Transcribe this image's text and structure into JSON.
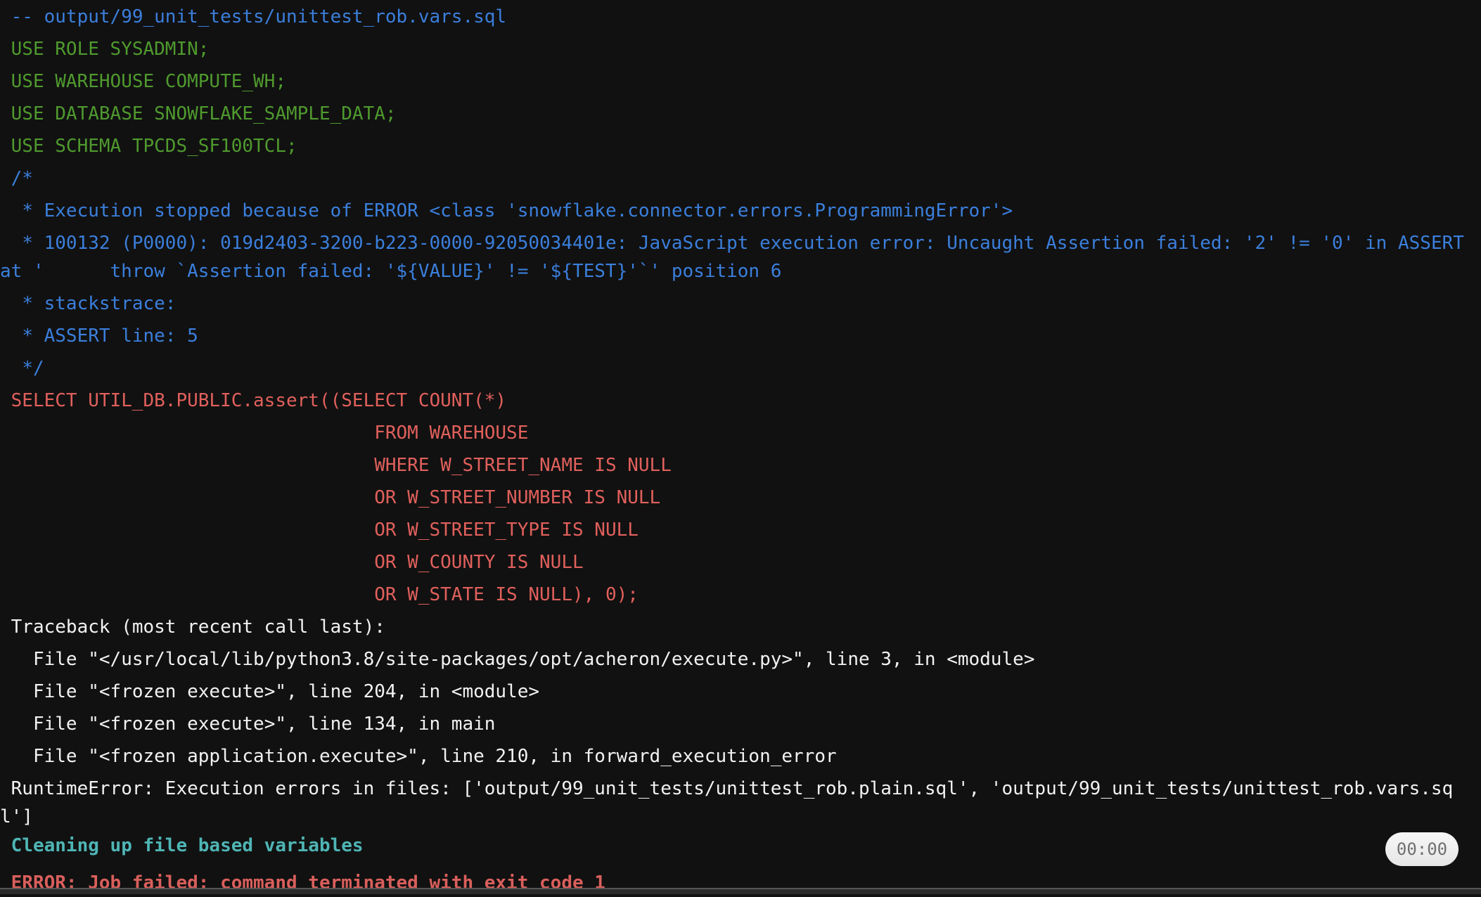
{
  "log": {
    "lines": [
      {
        "text": " -- output/99_unit_tests/unittest_rob.vars.sql",
        "style": "blue"
      },
      {
        "text": " USE ROLE SYSADMIN;",
        "style": "green"
      },
      {
        "text": " USE WAREHOUSE COMPUTE_WH;",
        "style": "green"
      },
      {
        "text": " USE DATABASE SNOWFLAKE_SAMPLE_DATA;",
        "style": "green"
      },
      {
        "text": " USE SCHEMA TPCDS_SF100TCL;",
        "style": "green"
      },
      {
        "text": " /*",
        "style": "blue"
      },
      {
        "text": "  * Execution stopped because of ERROR <class 'snowflake.connector.errors.ProgrammingError'>",
        "style": "blue"
      },
      {
        "text": "  * 100132 (P0000): 019d2403-3200-b223-0000-92050034401e: JavaScript execution error: Uncaught Assertion failed: '2' != '0' in ASSERT at '      throw `Assertion failed: '${VALUE}' != '${TEST}'`' position 6",
        "style": "blue"
      },
      {
        "text": "  * stackstrace:",
        "style": "blue"
      },
      {
        "text": "  * ASSERT line: 5",
        "style": "blue"
      },
      {
        "text": "  */",
        "style": "blue"
      },
      {
        "text": " SELECT UTIL_DB.PUBLIC.assert((SELECT COUNT(*)",
        "style": "red"
      },
      {
        "text": "                                  FROM WAREHOUSE",
        "style": "red"
      },
      {
        "text": "                                  WHERE W_STREET_NAME IS NULL",
        "style": "red"
      },
      {
        "text": "                                  OR W_STREET_NUMBER IS NULL",
        "style": "red"
      },
      {
        "text": "                                  OR W_STREET_TYPE IS NULL",
        "style": "red"
      },
      {
        "text": "                                  OR W_COUNTY IS NULL",
        "style": "red"
      },
      {
        "text": "                                  OR W_STATE IS NULL), 0);",
        "style": "red"
      },
      {
        "text": " Traceback (most recent call last):",
        "style": "white"
      },
      {
        "text": "   File \"</usr/local/lib/python3.8/site-packages/opt/acheron/execute.py>\", line 3, in <module>",
        "style": "white"
      },
      {
        "text": "   File \"<frozen execute>\", line 204, in <module>",
        "style": "white"
      },
      {
        "text": "   File \"<frozen execute>\", line 134, in main",
        "style": "white"
      },
      {
        "text": "   File \"<frozen application.execute>\", line 210, in forward_execution_error",
        "style": "white"
      },
      {
        "text": " RuntimeError: Execution errors in files: ['output/99_unit_tests/unittest_rob.plain.sql', 'output/99_unit_tests/unittest_rob.vars.sql']",
        "style": "white"
      }
    ],
    "cleaning": " Cleaning up file based variables",
    "job_failed": " ERROR: Job failed: command terminated with exit code 1"
  },
  "timer": {
    "label": "00:00"
  },
  "colors": {
    "background": "#111111",
    "comment_blue": "#3b7fdc",
    "sql_green": "#4f9a2e",
    "sql_red": "#e0605c",
    "info_teal": "#4fb5b5",
    "error_red": "#d95f5c"
  }
}
